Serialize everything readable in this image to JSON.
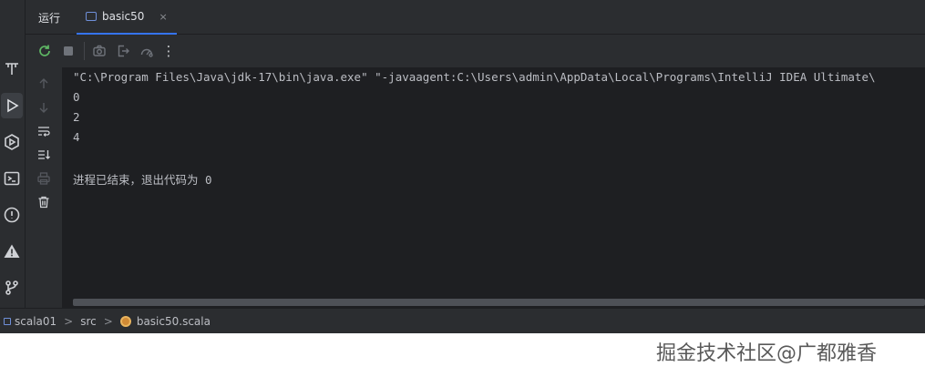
{
  "header": {
    "run_title": "运行",
    "tab_label": "basic50",
    "tab_close": "×"
  },
  "toolbar": {
    "icons": [
      "rerun-icon",
      "stop-icon",
      "camera-icon",
      "exit-icon",
      "profiler-icon",
      "more-icon"
    ],
    "more_label": "⋮"
  },
  "console": {
    "command_line": "\"C:\\Program Files\\Java\\jdk-17\\bin\\java.exe\" \"-javaagent:C:\\Users\\admin\\AppData\\Local\\Programs\\IntelliJ IDEA Ultimate\\",
    "output": [
      "0",
      "2",
      "4"
    ],
    "exit_message": "进程已结束，退出代码为 0"
  },
  "breadcrumb": {
    "items": [
      "scala01",
      "src",
      "basic50.scala"
    ],
    "separator": ">"
  },
  "watermark": {
    "text": "掘金技术社区@广都雅香"
  },
  "colors": {
    "background": "#1e1f22",
    "panel": "#2b2d30",
    "text": "#bcbec4",
    "accent": "#3574f0",
    "rerun_green": "#5fb865"
  }
}
